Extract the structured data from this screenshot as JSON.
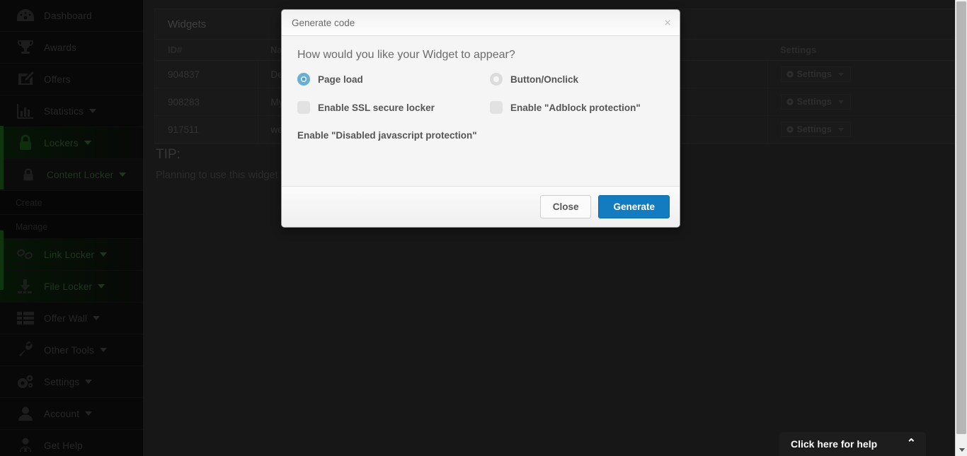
{
  "sidebar": {
    "items": [
      {
        "label": "Dashboard",
        "icon": "dashboard-gauge-icon",
        "caret": false,
        "active": false
      },
      {
        "label": "Awards",
        "icon": "trophy-icon",
        "caret": false,
        "active": false
      },
      {
        "label": "Offers",
        "icon": "pencil-note-icon",
        "caret": false,
        "active": false
      },
      {
        "label": "Statistics",
        "icon": "bar-chart-icon",
        "caret": true,
        "active": false
      },
      {
        "label": "Lockers",
        "icon": "padlock-icon",
        "caret": true,
        "active": true
      },
      {
        "label": "Content Locker",
        "icon": "lock-small-icon",
        "caret": true,
        "active": true
      }
    ],
    "subitems": [
      {
        "label": "Create"
      },
      {
        "label": "Manage"
      }
    ],
    "items2": [
      {
        "label": "Link Locker",
        "icon": "chain-link-icon",
        "caret": true,
        "active": true
      },
      {
        "label": "File Locker",
        "icon": "download-icon",
        "caret": true,
        "active": true
      },
      {
        "label": "Offer Wall",
        "icon": "grid-list-icon",
        "caret": true,
        "active": false
      },
      {
        "label": "Other Tools",
        "icon": "wrench-icon",
        "caret": true,
        "active": false
      },
      {
        "label": "Settings",
        "icon": "gears-icon",
        "caret": true,
        "active": false
      },
      {
        "label": "Account",
        "icon": "user-icon",
        "caret": true,
        "active": false
      },
      {
        "label": "Get Help",
        "icon": "support-agent-icon",
        "caret": false,
        "active": false
      }
    ]
  },
  "main": {
    "panel_title": "Widgets",
    "table": {
      "headers": [
        "ID#",
        "Name",
        "",
        "",
        "Settings"
      ],
      "rows": [
        {
          "id": "904837",
          "name": "Desk",
          "settings_label": "Settings"
        },
        {
          "id": "908283",
          "name": "My c",
          "settings_label": "Settings"
        },
        {
          "id": "917511",
          "name": "web",
          "settings_label": "Settings"
        }
      ]
    },
    "tip": {
      "heading": "TIP:",
      "body": "Planning to use this widget to your posts, pages, and categories."
    }
  },
  "help_bar": {
    "label": "Click here for help",
    "chevron": "⌃"
  },
  "modal": {
    "title": "Generate code",
    "close_icon": "×",
    "question": "How would you like your Widget to appear?",
    "options": [
      {
        "type": "radio",
        "label": "Page load",
        "checked": true
      },
      {
        "type": "radio",
        "label": "Button/Onclick",
        "checked": false
      },
      {
        "type": "checkbox",
        "label": "Enable SSL secure locker",
        "checked": false
      },
      {
        "type": "checkbox",
        "label": "Enable \"Adblock protection\"",
        "checked": false
      },
      {
        "type": "checkbox",
        "label": "Enable \"Disabled javascript protection\"",
        "checked": false
      }
    ],
    "buttons": {
      "close": "Close",
      "generate": "Generate"
    }
  },
  "colors": {
    "accent_blue": "#137cc1",
    "radio_blue": "#68aed6",
    "sidebar_bg": "#111111",
    "sidebar_active_green": "#1d6b1d",
    "modal_bg": "#f5f5f5"
  }
}
